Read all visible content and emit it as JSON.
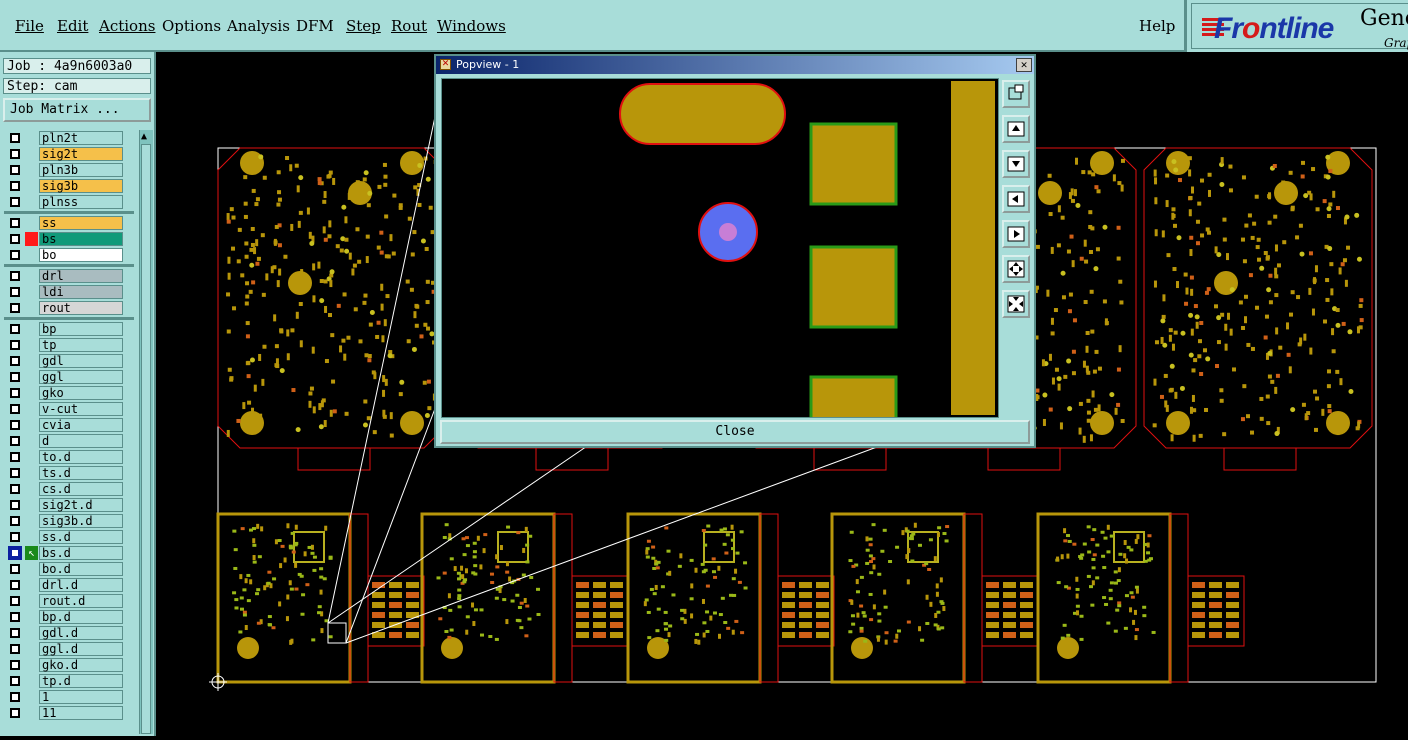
{
  "menu": {
    "items": [
      "File",
      "Edit",
      "Actions",
      "Options",
      "Analysis",
      "DFM",
      "Step",
      "Rout",
      "Windows"
    ],
    "help": "Help"
  },
  "logo": {
    "brand_pre": "Fr",
    "brand_o": "o",
    "brand_post": "ntline",
    "gene": "Gene",
    "grap": "Grap"
  },
  "job": {
    "job_label": "Job : 4a9n6003a0",
    "step_label": "Step: cam",
    "matrix_button": "Job Matrix ..."
  },
  "layers": [
    {
      "name": "pln2t",
      "color": "#a8ddd9"
    },
    {
      "name": "sig2t",
      "color": "#f5c04a"
    },
    {
      "name": "pln3b",
      "color": "#a8ddd9"
    },
    {
      "name": "sig3b",
      "color": "#f5c04a"
    },
    {
      "name": "plnss",
      "color": "#a8ddd9"
    },
    {
      "name": "ss",
      "color": "#f5c04a"
    },
    {
      "name": "bs",
      "color": "#119a7a",
      "swatch": "#ff1a1a"
    },
    {
      "name": "bo",
      "color": "#ffffff"
    },
    {
      "name": "drl",
      "color": "#a9bcc0"
    },
    {
      "name": "ldi",
      "color": "#a9bcc0"
    },
    {
      "name": "rout",
      "color": "#d6d6d6"
    },
    {
      "name": "bp",
      "color": "#a8ddd9"
    },
    {
      "name": "tp",
      "color": "#a8ddd9"
    },
    {
      "name": "gdl",
      "color": "#a8ddd9"
    },
    {
      "name": "ggl",
      "color": "#a8ddd9"
    },
    {
      "name": "gko",
      "color": "#a8ddd9"
    },
    {
      "name": "v-cut",
      "color": "#a8ddd9"
    },
    {
      "name": "cvia",
      "color": "#a8ddd9"
    },
    {
      "name": "d",
      "color": "#a8ddd9"
    },
    {
      "name": "to.d",
      "color": "#a8ddd9"
    },
    {
      "name": "ts.d",
      "color": "#a8ddd9"
    },
    {
      "name": "cs.d",
      "color": "#a8ddd9"
    },
    {
      "name": "sig2t.d",
      "color": "#a8ddd9"
    },
    {
      "name": "sig3b.d",
      "color": "#a8ddd9"
    },
    {
      "name": "ss.d",
      "color": "#a8ddd9"
    },
    {
      "name": "bs.d",
      "color": "#a8ddd9",
      "active": true
    },
    {
      "name": "bo.d",
      "color": "#a8ddd9"
    },
    {
      "name": "drl.d",
      "color": "#a8ddd9"
    },
    {
      "name": "rout.d",
      "color": "#a8ddd9"
    },
    {
      "name": "bp.d",
      "color": "#a8ddd9"
    },
    {
      "name": "gdl.d",
      "color": "#a8ddd9"
    },
    {
      "name": "ggl.d",
      "color": "#a8ddd9"
    },
    {
      "name": "gko.d",
      "color": "#a8ddd9"
    },
    {
      "name": "tp.d",
      "color": "#a8ddd9"
    },
    {
      "name": "1",
      "color": "#a8ddd9"
    },
    {
      "name": "11",
      "color": "#a8ddd9"
    }
  ],
  "popview": {
    "title": "Popview - 1",
    "close_button": "Close",
    "close_x": "✕"
  },
  "colors": {
    "pad": "#b8960a",
    "outline": "#e01010",
    "pad_border": "#2a9a18",
    "via_fill": "#5a6ef0",
    "via_core": "#c77ed6",
    "panel_bg": "#a8ddd9"
  }
}
